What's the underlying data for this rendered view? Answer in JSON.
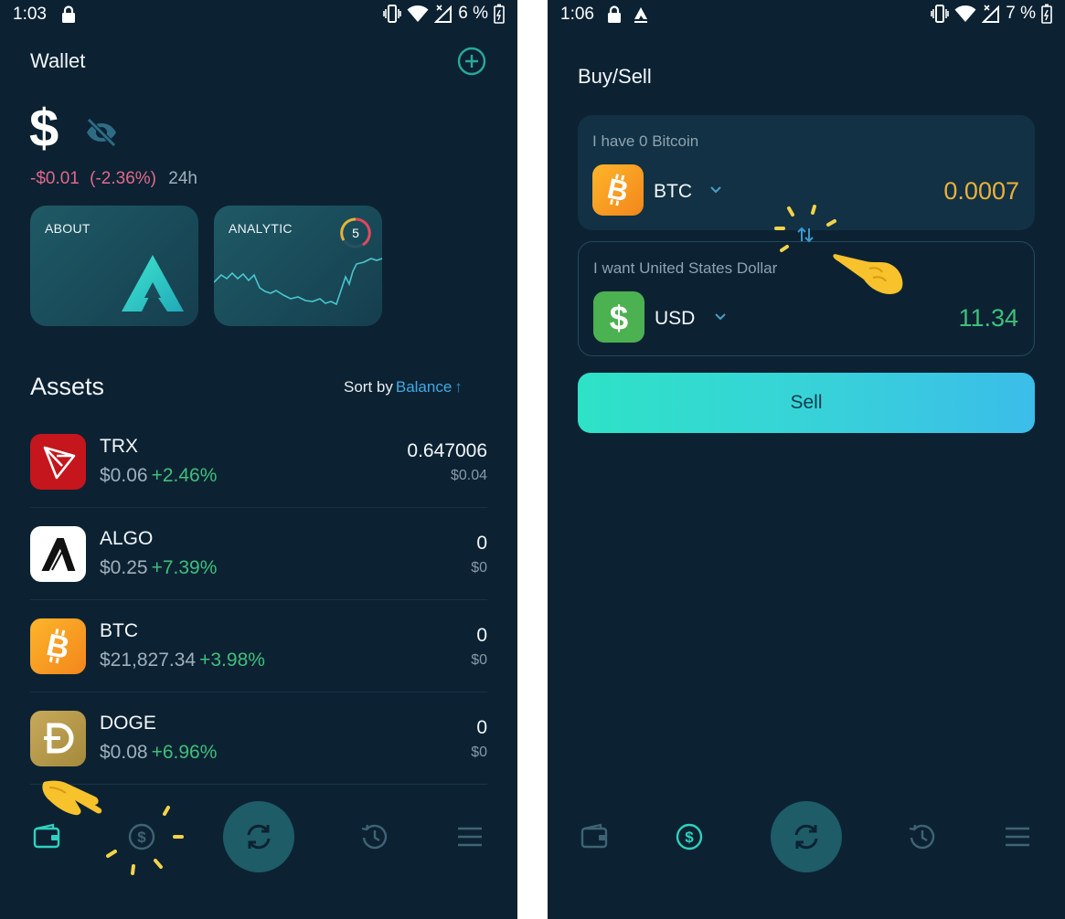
{
  "left": {
    "status": {
      "time": "1:03",
      "battery": "6 %"
    },
    "header": {
      "title": "Wallet"
    },
    "balance": {
      "symbol": "$",
      "change_amount": "-$0.01",
      "change_pct": "(-2.36%)",
      "period": "24h"
    },
    "cards": {
      "about": "ABOUT",
      "analytic": "ANALYTIC",
      "analytic_badge": "5"
    },
    "assets": {
      "title": "Assets",
      "sort_label": "Sort by",
      "sort_value": "Balance",
      "sort_arrow": "↑",
      "items": [
        {
          "name": "TRX",
          "price": "$0.06",
          "change": "+2.46%",
          "amount": "0.647006",
          "value": "$0.04",
          "icon": "tron-icon"
        },
        {
          "name": "ALGO",
          "price": "$0.25",
          "change": "+7.39%",
          "amount": "0",
          "value": "$0",
          "icon": "algorand-icon"
        },
        {
          "name": "BTC",
          "price": "$21,827.34",
          "change": "+3.98%",
          "amount": "0",
          "value": "$0",
          "icon": "bitcoin-icon"
        },
        {
          "name": "DOGE",
          "price": "$0.08",
          "change": "+6.96%",
          "amount": "0",
          "value": "$0",
          "icon": "dogecoin-icon"
        }
      ]
    },
    "nav": [
      "wallet-icon",
      "dollar-icon",
      "swap-icon",
      "history-icon",
      "menu-icon"
    ]
  },
  "right": {
    "status": {
      "time": "1:06",
      "battery": "7 %"
    },
    "header": {
      "title": "Buy/Sell"
    },
    "have": {
      "caption": "I have 0 Bitcoin",
      "code": "BTC",
      "amount": "0.0007"
    },
    "want": {
      "caption": "I want United States Dollar",
      "code": "USD",
      "amount": "11.34"
    },
    "sell_button": "Sell",
    "nav": [
      "wallet-icon",
      "dollar-icon",
      "swap-icon",
      "history-icon",
      "menu-icon"
    ]
  },
  "colors": {
    "background": "#0c2233",
    "accent": "#2ee2c6",
    "positive": "#3fbf79",
    "negative": "#e1688a",
    "link": "#43a8e2"
  }
}
